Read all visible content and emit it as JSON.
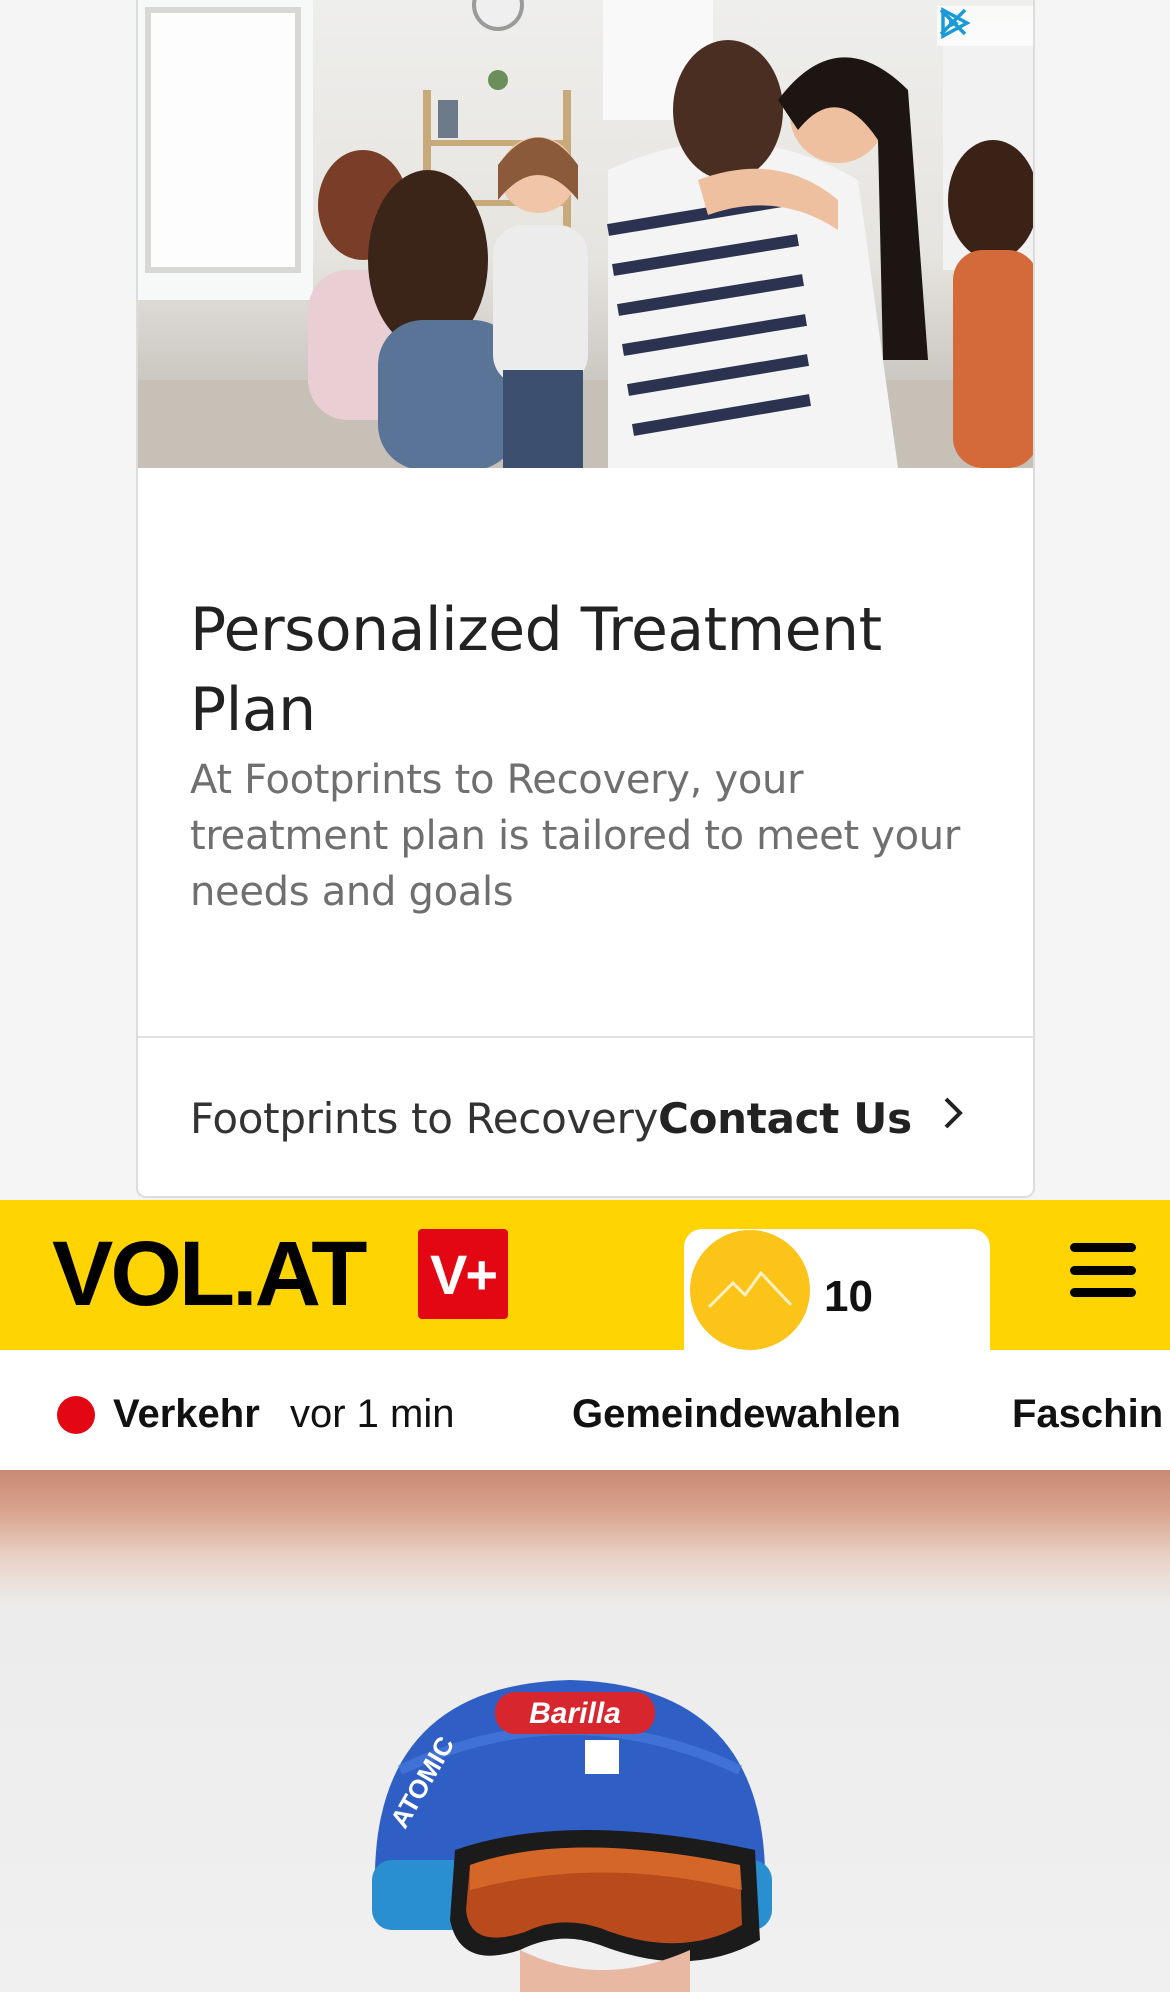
{
  "ad": {
    "title": "Personalized Treatment Plan",
    "description": "At Footprints to Recovery, your treatment plan is tailored to meet your needs and goals",
    "advertiser": "Footprints to Recovery",
    "cta_label": "Contact Us",
    "icons": [
      "adchoices-icon",
      "close-icon",
      "chevron-right-icon"
    ],
    "image": "group-therapy-hug-photo"
  },
  "header": {
    "logo": "VOL.AT",
    "plus_badge": "V+",
    "weather": {
      "temperature": "10",
      "icon": "mountain-sun-icon"
    },
    "menu_icon": "hamburger-icon",
    "background": "#ffd400"
  },
  "ticker": {
    "live_label": "Verkehr",
    "live_time": "vor 1 min",
    "items": [
      "Gemeindewahlen",
      "Faschin"
    ],
    "live_color": "#e30613"
  },
  "hero": {
    "image": "skier-helmet-photo",
    "helmet_text": "Barilla",
    "helmet_brand": "ATOMIC"
  }
}
